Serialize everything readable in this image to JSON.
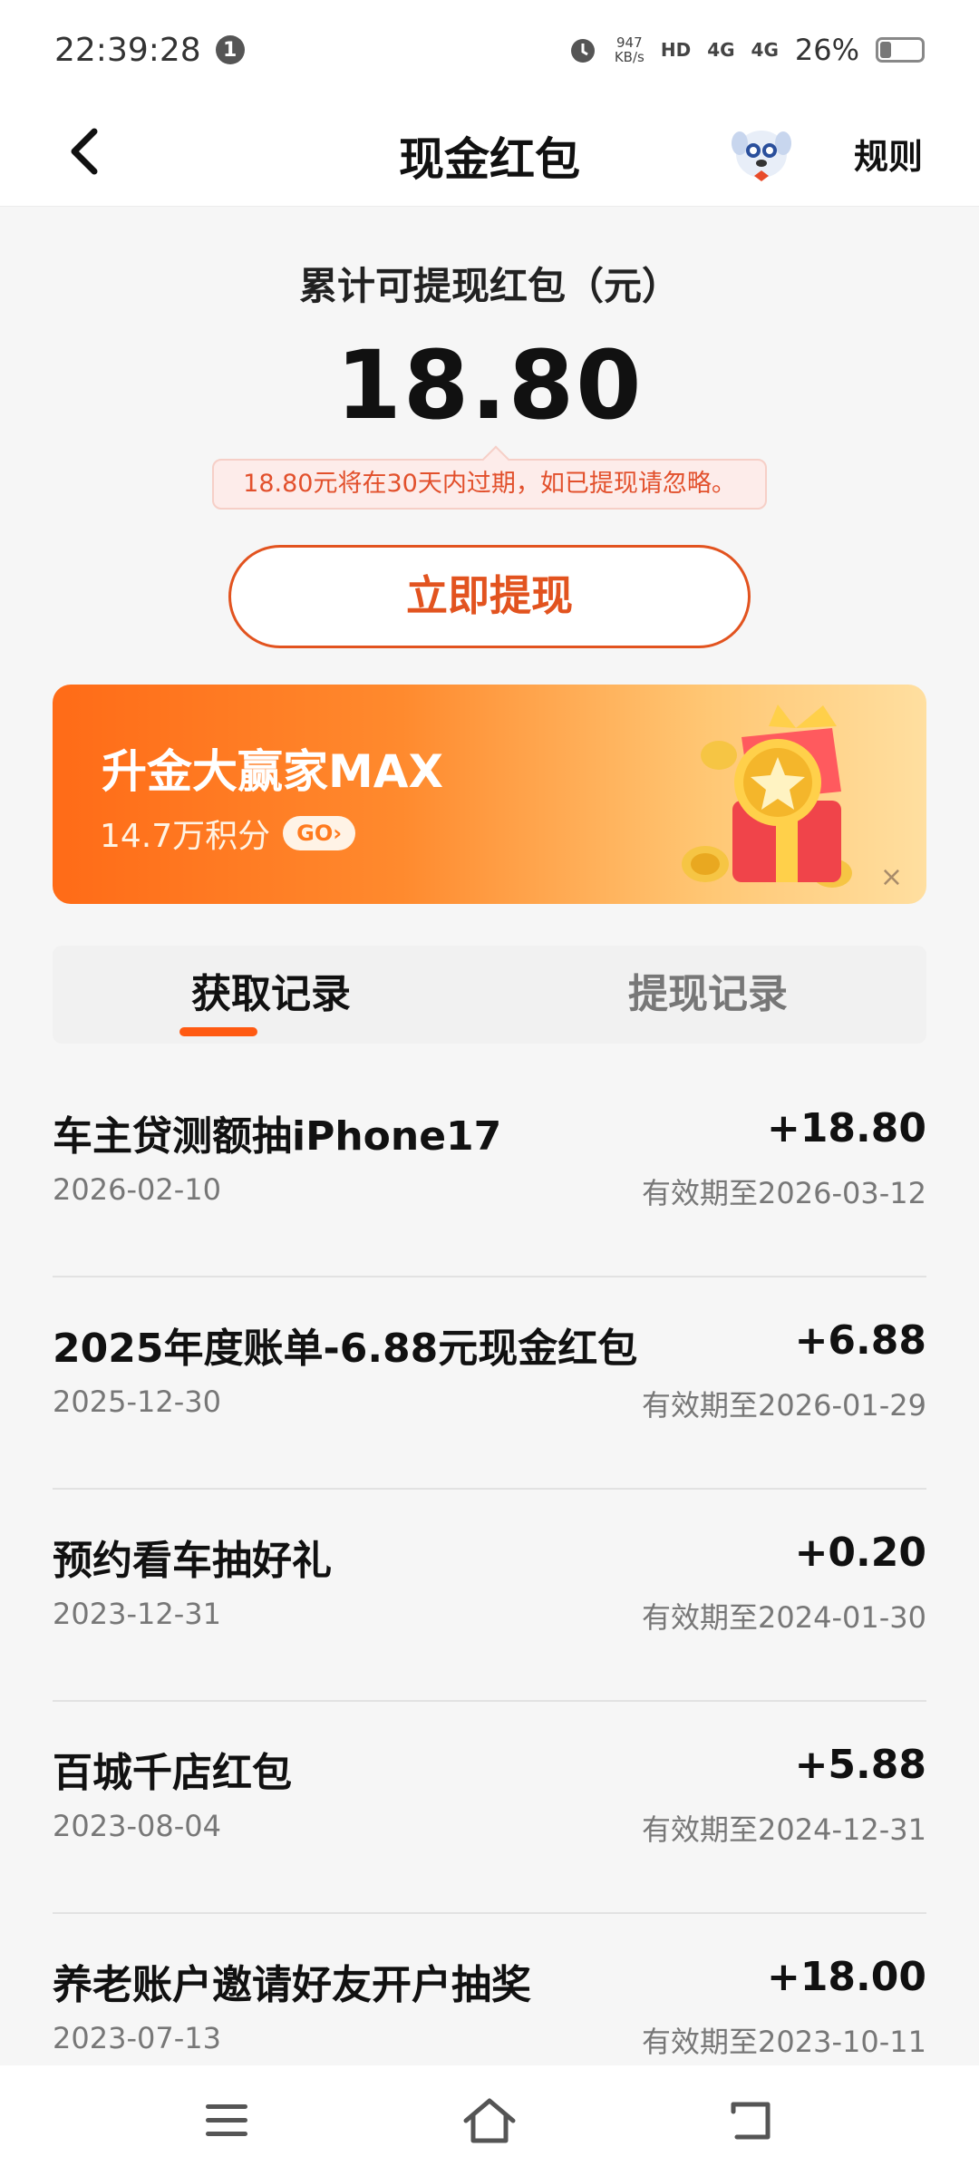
{
  "status_bar": {
    "time": "22:39:28",
    "notif_count": "1",
    "net_speed_value": "947",
    "net_speed_unit": "KB/s",
    "hd_label": "HD",
    "sig1": "4G",
    "sig2": "4G",
    "battery": "26%",
    "battery_level": 0.26
  },
  "header": {
    "title": "现金红包",
    "rules": "规则"
  },
  "balance": {
    "label": "累计可提现红包（元）",
    "amount": "18.80",
    "expire_tip": "18.80元将在30天内过期，如已提现请忽略。",
    "withdraw_button": "立即提现"
  },
  "banner": {
    "title": "升金大赢家MAX",
    "subtitle": "14.7万积分",
    "go": "GO",
    "close": "×"
  },
  "tabs": [
    {
      "label": "获取记录",
      "active": true
    },
    {
      "label": "提现记录",
      "active": false
    }
  ],
  "records": [
    {
      "title": "车主贷测额抽iPhone17",
      "amount": "+18.80",
      "date": "2026-02-10",
      "expiry": "有效期至2026-03-12"
    },
    {
      "title": "2025年度账单-6.88元现金红包",
      "amount": "+6.88",
      "date": "2025-12-30",
      "expiry": "有效期至2026-01-29"
    },
    {
      "title": "预约看车抽好礼",
      "amount": "+0.20",
      "date": "2023-12-31",
      "expiry": "有效期至2024-01-30"
    },
    {
      "title": "百城千店红包",
      "amount": "+5.88",
      "date": "2023-08-04",
      "expiry": "有效期至2024-12-31"
    },
    {
      "title": "养老账户邀请好友开户抽奖",
      "amount": "+18.00",
      "date": "2023-07-13",
      "expiry": "有效期至2023-10-11"
    }
  ],
  "colors": {
    "accent": "#e2531f",
    "tab_indicator": "#ff5a12",
    "tip_text": "#e2502c"
  }
}
